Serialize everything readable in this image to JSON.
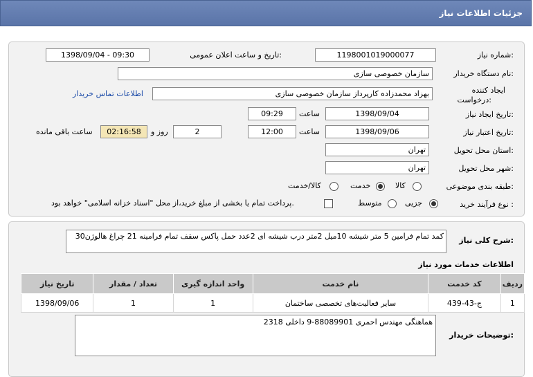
{
  "header": {
    "title": "جزئیات اطلاعات نیاز"
  },
  "form": {
    "need_number_label": "شماره نیاز:",
    "need_number": "1198001019000077",
    "announce_label": "تاریخ و ساعت اعلان عمومی:",
    "announce_value": "1398/09/04 - 09:30",
    "buyer_org_label": "نام دستگاه خریدار:",
    "buyer_org": "سازمان خصوصی سازی",
    "creator_label_1": "ایجاد کننده",
    "creator_label_2": "درخواست:",
    "creator": "بهزاد محمدزاده کارپرداز سازمان خصوصی سازی",
    "contact_link": "اطلاعات تماس خریدار",
    "created_date_label": "تاریخ ایجاد نیاز:",
    "created_date": "1398/09/04",
    "time_label": "ساعت",
    "created_time": "09:29",
    "validity_label": "تاریخ اعتبار نیاز:",
    "validity_date": "1398/09/06",
    "validity_time": "12:00",
    "days_value": "2",
    "days_label": "روز و",
    "remaining_time": "02:16:58",
    "remaining_label": "ساعت باقی مانده",
    "province_label": "استان محل تحویل:",
    "province": "تهران",
    "city_label": "شهر محل تحویل:",
    "city": "تهران",
    "category_label": "طبقه بندی موضوعی:",
    "category_goods": "کالا",
    "category_service": "خدمت",
    "category_goods_service": "کالا/خدمت",
    "process_label": "نوع فرآیند خرید :",
    "process_partial": "جزیی",
    "process_medium": "متوسط",
    "payment_note": "پرداخت تمام یا بخشی از مبلغ خرید،از محل \"اسناد خزانه اسلامی\" خواهد بود."
  },
  "description": {
    "label": "شرح کلی نیاز:",
    "text": "کمد تمام فرامین 5 متر شیشه 10میل 2متر درب شیشه ای 2عدد حمل پاکس سقف تمام فرامینه 21 چراغ هالوژن30"
  },
  "services": {
    "title": "اطلاعات خدمات مورد نیاز",
    "columns": [
      "ردیف",
      "کد خدمت",
      "نام خدمت",
      "واحد اندازه گیری",
      "تعداد / مقدار",
      "تاریخ نیاز"
    ],
    "rows": [
      [
        "1",
        "ج-43-439",
        "سایر فعالیت‌های تخصصی ساختمان",
        "1",
        "1",
        "1398/09/06"
      ]
    ]
  },
  "buyer_notes": {
    "label": "توضیحات خریدار:",
    "text": "هماهنگی مهندس احمری 88089901-9 داخلی 2318"
  }
}
